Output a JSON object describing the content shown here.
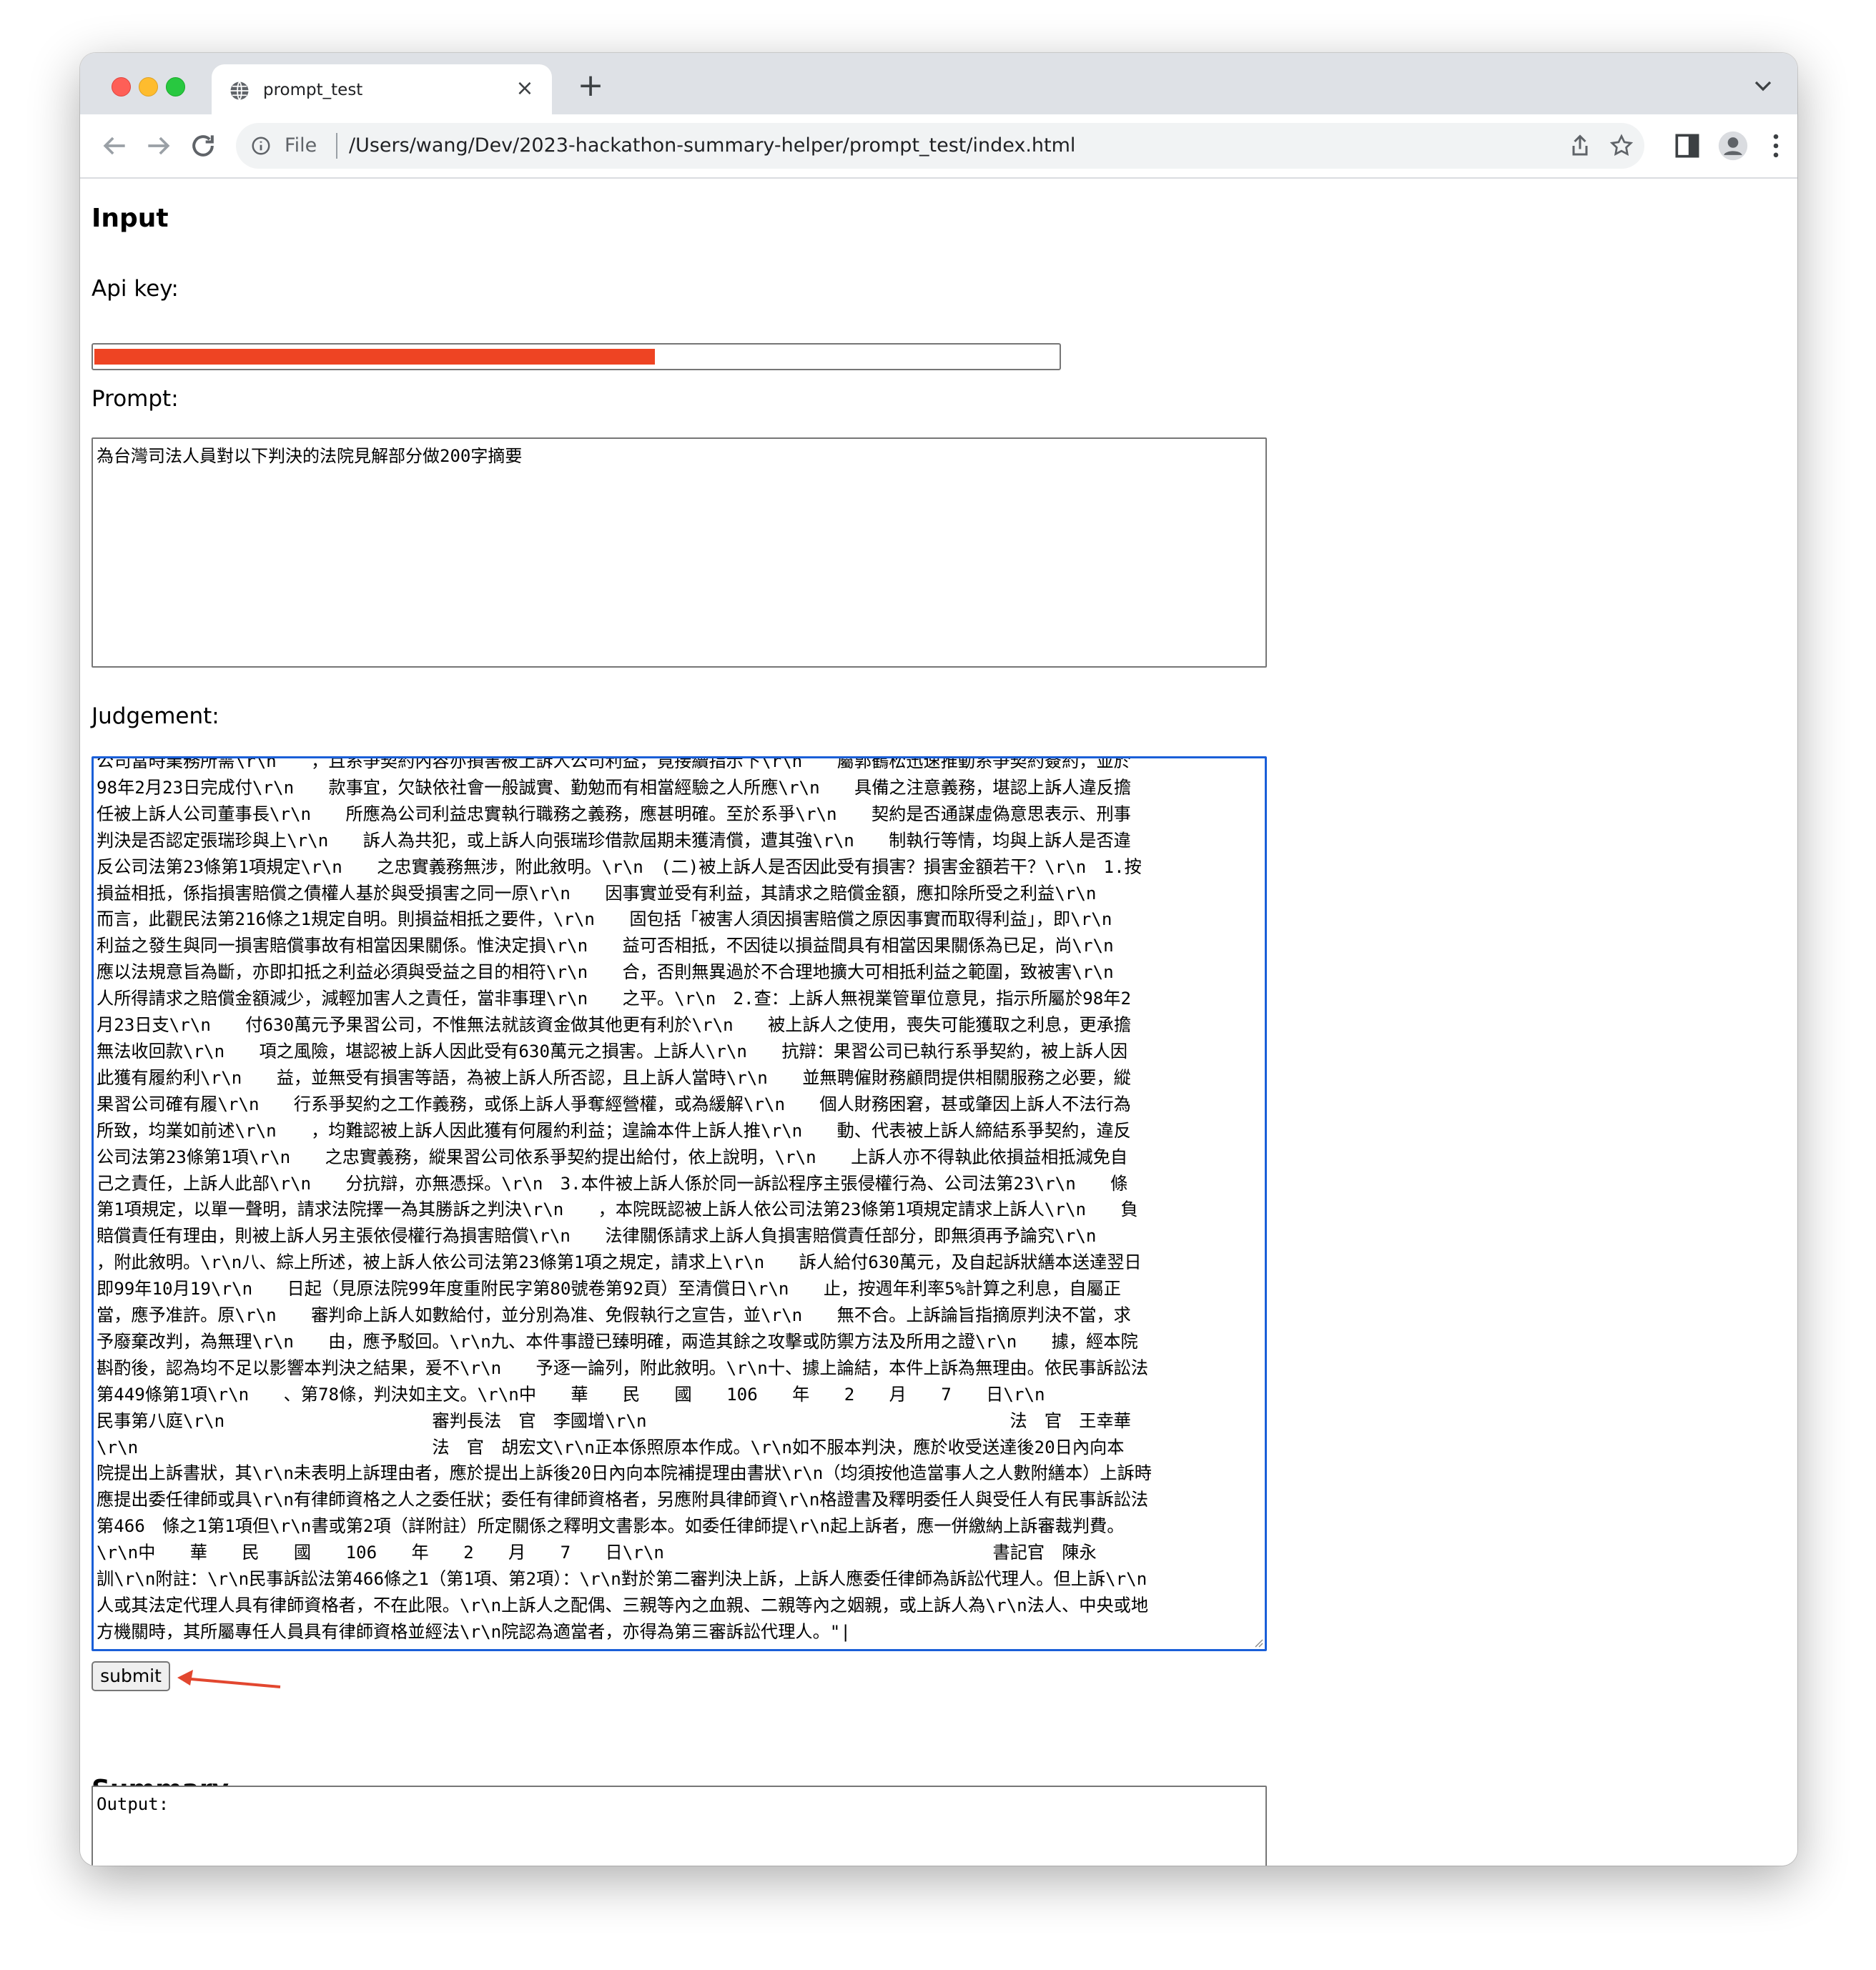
{
  "browser": {
    "tab_title": "prompt_test",
    "scheme_label": "File",
    "url": "/Users/wang/Dev/2023-hackathon-summary-helper/prompt_test/index.html",
    "new_tab_symbol": "+",
    "close_symbol": "×"
  },
  "page": {
    "input_heading": "Input",
    "api_key_label": "Api key:",
    "prompt_label": "Prompt:",
    "prompt_value": "為台灣司法人員對以下判決的法院見解部分做200字摘要",
    "judgement_label": "Judgement:",
    "judgement_lines": [
      "公司當時業務所需\\r\\n　　，且系爭契約內容亦損害被上訴人公司利益，竟接續指示下\\r\\n　　屬郭鶴松迅速推動系爭契約簽約，並於",
      "98年2月23日完成付\\r\\n　　款事宜，欠缺依社會一般誠實、勤勉而有相當經驗之人所應\\r\\n　　具備之注意義務，堪認上訴人違反擔",
      "任被上訴人公司董事長\\r\\n　　所應為公司利益忠實執行職務之義務，應甚明確。至於系爭\\r\\n　　契約是否通謀虛偽意思表示、刑事",
      "判決是否認定張瑞珍與上\\r\\n　　訴人為共犯，或上訴人向張瑞珍借款屆期未獲清償，遭其強\\r\\n　　制執行等情，均與上訴人是否違",
      "反公司法第23條第1項規定\\r\\n　　之忠實義務無涉，附此敘明。\\r\\n　(二)被上訴人是否因此受有損害？損害金額若干？\\r\\n　1.按",
      "損益相抵，係指損害賠償之債權人基於與受損害之同一原\\r\\n　　因事實並受有利益，其請求之賠償金額，應扣除所受之利益\\r\\n",
      "而言，此觀民法第216條之1規定自明。則損益相抵之要件，\\r\\n　　固包括「被害人須因損害賠償之原因事實而取得利益」，即\\r\\n",
      "利益之發生與同一損害賠償事故有相當因果關係。惟決定損\\r\\n　　益可否相抵，不因徒以損益間具有相當因果關係為已足，尚\\r\\n",
      "應以法規意旨為斷，亦即扣抵之利益必須與受益之目的相符\\r\\n　　合，否則無異過於不合理地擴大可相抵利益之範圍，致被害\\r\\n",
      "人所得請求之賠償金額減少，減輕加害人之責任，當非事理\\r\\n　　之平。\\r\\n　2.查：上訴人無視業管單位意見，指示所屬於98年2",
      "月23日支\\r\\n　　付630萬元予果習公司，不惟無法就該資金做其他更有利於\\r\\n　　被上訴人之使用，喪失可能獲取之利息，更承擔",
      "無法收回款\\r\\n　　項之風險，堪認被上訴人因此受有630萬元之損害。上訴人\\r\\n　　抗辯：果習公司已執行系爭契約，被上訴人因",
      "此獲有履約利\\r\\n　　益，並無受有損害等語，為被上訴人所否認，且上訴人當時\\r\\n　　並無聘僱財務顧問提供相關服務之必要，縱",
      "果習公司確有履\\r\\n　　行系爭契約之工作義務，或係上訴人爭奪經營權，或為緩解\\r\\n　　個人財務困窘，甚或肇因上訴人不法行為",
      "所致，均業如前述\\r\\n　　，均難認被上訴人因此獲有何履約利益；遑論本件上訴人推\\r\\n　　動、代表被上訴人締結系爭契約，違反",
      "公司法第23條第1項\\r\\n　　之忠實義務，縱果習公司依系爭契約提出給付，依上說明，\\r\\n　　上訴人亦不得執此依損益相抵減免自",
      "己之責任，上訴人此部\\r\\n　　分抗辯，亦無憑採。\\r\\n　3.本件被上訴人係於同一訴訟程序主張侵權行為、公司法第23\\r\\n　　條",
      "第1項規定，以單一聲明，請求法院擇一為其勝訴之判決\\r\\n　　，本院既認被上訴人依公司法第23條第1項規定請求上訴人\\r\\n　　負",
      "賠償責任有理由，則被上訴人另主張依侵權行為損害賠償\\r\\n　　法律關係請求上訴人負損害賠償責任部分，即無須再予論究\\r\\n",
      "，附此敘明。\\r\\n八、綜上所述，被上訴人依公司法第23條第1項之規定，請求上\\r\\n　　訴人給付630萬元，及自起訴狀繕本送達翌日",
      "即99年10月19\\r\\n　　日起（見原法院99年度重附民字第80號卷第92頁）至清償日\\r\\n　　止，按週年利率5%計算之利息，自屬正",
      "當，應予准許。原\\r\\n　　審判命上訴人如數給付，並分別為准、免假執行之宣告，並\\r\\n　　無不合。上訴論旨指摘原判決不當，求",
      "予廢棄改判，為無理\\r\\n　　由，應予駁回。\\r\\n九、本件事證已臻明確，兩造其餘之攻擊或防禦方法及所用之證\\r\\n　　據，經本院",
      "斟酌後，認為均不足以影響本判決之結果，爰不\\r\\n　　予逐一論列，附此敘明。\\r\\n十、據上論結，本件上訴為無理由。依民事訴訟法",
      "第449條第1項\\r\\n　　、第78條，判決如主文。\\r\\n中　　華　　民　　國　　106　　年　　2　　月　　7　　日\\r\\n",
      "民事第八庭\\r\\n　　　　　　　　　　　　審判長法　官　李國增\\r\\n　　　　　　　　　　　　　　　　　　　　　法　官　王幸華",
      "\\r\\n　　　　　　　　　　　　　　　　　法　官　胡宏文\\r\\n正本係照原本作成。\\r\\n如不服本判決，應於收受送達後20日內向本",
      "院提出上訴書狀，其\\r\\n未表明上訴理由者，應於提出上訴後20日內向本院補提理由書狀\\r\\n（均須按他造當事人之人數附繕本）上訴時",
      "應提出委任律師或具\\r\\n有律師資格之人之委任狀；委任有律師資格者，另應附具律師資\\r\\n格證書及釋明委任人與受任人有民事訴訟法",
      "第466　條之1第1項但\\r\\n書或第2項（詳附註）所定關係之釋明文書影本。如委任律師提\\r\\n起上訴者，應一併繳納上訴審裁判費。",
      "\\r\\n中　　華　　民　　國　　106　　年　　2　　月　　7　　日\\r\\n　　　　　　　　　　　　　　　　　　　書記官　陳永",
      "訓\\r\\n附註：\\r\\n民事訴訟法第466條之1（第1項、第2項）：\\r\\n對於第二審判決上訴，上訴人應委任律師為訴訟代理人。但上訴\\r\\n",
      "人或其法定代理人具有律師資格者，不在此限。\\r\\n上訴人之配偶、三親等內之血親、二親等內之姻親，或上訴人為\\r\\n法人、中央或地",
      "方機關時，其所屬專任人員具有律師資格並經法\\r\\n院認為適當者，亦得為第三審訴訟代理人。\"|"
    ],
    "submit_label": "submit",
    "summary_heading": "Summary",
    "output_value": "Output:"
  },
  "colors": {
    "redaction": "#ee4423",
    "annotation_arrow": "#e2472f",
    "focus_border": "#1a5fd8"
  },
  "icons": {
    "tab_favicon": "globe-icon",
    "back": "arrow-left-icon",
    "forward": "arrow-right-icon",
    "reload": "reload-icon",
    "info": "info-icon",
    "share": "share-icon",
    "bookmark": "star-icon",
    "side_panel": "side-panel-icon",
    "profile": "profile-icon",
    "menu": "kebab-menu-icon"
  }
}
